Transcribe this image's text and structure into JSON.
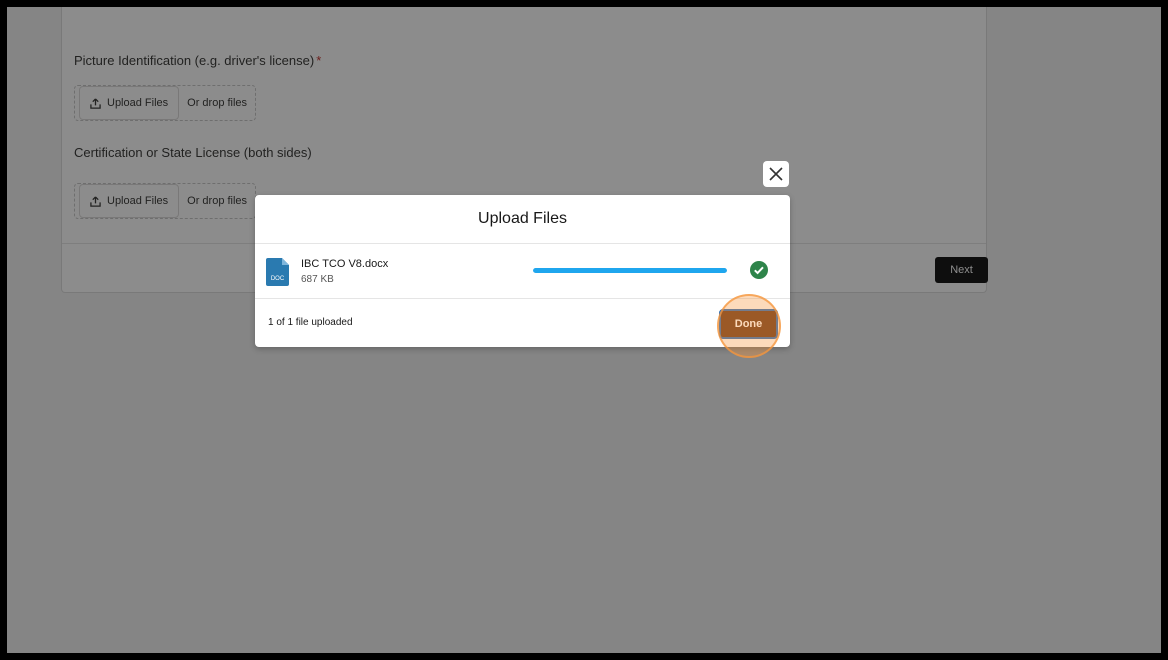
{
  "form": {
    "field1": {
      "label": "Picture Identification (e.g. driver's license)",
      "required_marker": "*"
    },
    "field2": {
      "label": "Certification or State License (both sides)"
    },
    "upload_label": "Upload Files",
    "drop_text": "Or drop files",
    "next_label": "Next"
  },
  "modal": {
    "title": "Upload Files",
    "file": {
      "name": "IBC TCO V8.docx",
      "size": "687 KB",
      "type_badge": "DOC",
      "progress_percent": 100,
      "status_icon": "check-circle-icon"
    },
    "footer_status": "1 of 1 file uploaded",
    "done_label": "Done",
    "close_icon": "close-icon"
  },
  "colors": {
    "next_button": "#1a1a1a",
    "done_button": "#6b3a1b",
    "progress": "#1fa6ee",
    "success": "#2e844a",
    "doc_icon": "#2a7ab0",
    "required": "#c23934",
    "click_highlight": "#f5963c"
  }
}
